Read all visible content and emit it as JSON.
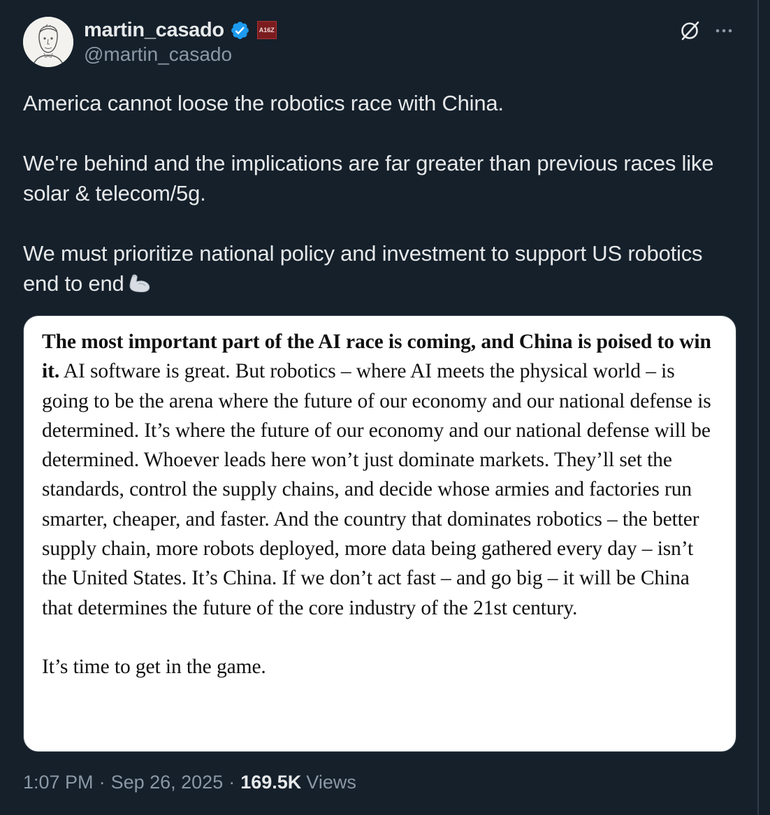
{
  "author": {
    "display_name": "martin_casado",
    "handle": "@martin_casado",
    "verified": true,
    "affiliation_badge": "A16Z",
    "avatar": "sketch-portrait-avatar"
  },
  "header_actions": {
    "grok_icon": "grok-slash-circle-icon",
    "more_icon": "more-horizontal-icon"
  },
  "tweet": {
    "paragraphs": [
      "America cannot loose the robotics race with China.",
      "We're behind and the implications are far greater than previous races like solar & telecom/5g.",
      "We must prioritize national policy and investment to support US robotics end to end"
    ],
    "emoji": "flexed-biceps"
  },
  "media": {
    "bold_lead": "The most important part of the AI race is coming, and China is poised to win it.",
    "body": " AI software is great. But robotics – where AI meets the physical world – is going to be the arena where the future of our economy and our national defense is determined. It’s where the future of our economy and our national defense will be determined. Whoever leads here won’t just dominate markets. They’ll set the standards, control the supply chains, and decide whose armies and factories run smarter, cheaper, and faster. And the country that dominates robotics – the better supply chain, more robots deployed, more data being gathered every day – isn’t the United States. It’s China. If we don’t act fast – and go big – it will be China that determines the future of the core industry of the 21st century.",
    "closing": "It’s time to get in the game."
  },
  "meta": {
    "time": "1:07 PM",
    "date": "Sep 26, 2025",
    "views_count": "169.5K",
    "views_label": "Views"
  },
  "colors": {
    "background": "#15202b",
    "text_primary": "#e7e9ea",
    "text_secondary": "#8b98a5",
    "verified_blue": "#1d9bf0"
  }
}
